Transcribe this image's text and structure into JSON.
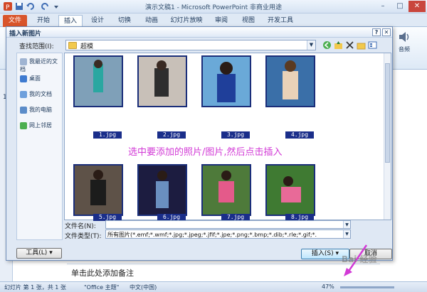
{
  "app": {
    "title": "演示文稿1 - Microsoft PowerPoint 非商业用途"
  },
  "tabs": [
    "文件",
    "开始",
    "插入",
    "设计",
    "切换",
    "动画",
    "幻灯片放映",
    "审阅",
    "视图",
    "开发工具"
  ],
  "ribbon": {
    "audio_label": "音频"
  },
  "slide_pane": {
    "thumb_number": "1"
  },
  "dialog": {
    "title": "插入新图片",
    "lookin_label": "查找范围(I):",
    "lookin_value": "超模",
    "places": [
      "我最近的文档",
      "桌面",
      "我的文档",
      "我的电脑",
      "网上邻居"
    ],
    "files": [
      {
        "name": "1.jpg"
      },
      {
        "name": "2.jpg"
      },
      {
        "name": "3.jpg"
      },
      {
        "name": "4.jpg"
      },
      {
        "name": "5.jpg"
      },
      {
        "name": "6.jpg"
      },
      {
        "name": "7.jpg"
      },
      {
        "name": "8.jpg"
      }
    ],
    "annotation": "选中要添加的照片/图片,然后点击插入",
    "filename_label": "文件名(N):",
    "filename_value": "",
    "filetype_label": "文件类型(T):",
    "filetype_value": "所有图片(*.emf;*.wmf;*.jpg;*.jpeg;*.jfif;*.jpe;*.png;*.bmp;*.dib;*.rle;*.gif;*.",
    "tools_button": "工具(L)",
    "insert_button": "插入(S)",
    "cancel_button": "取消"
  },
  "notes": {
    "placeholder": "单击此处添加备注"
  },
  "status": {
    "slide_info": "幻灯片 第 1 张，共 1 张",
    "theme": "\"Office 主题\"",
    "language": "中文(中国)",
    "zoom": "47%"
  },
  "watermark": "Bai 经验",
  "colors": {
    "file_tab": "#d9552b",
    "annotation": "#d23ad6",
    "caption_bg": "#1a2e8a"
  }
}
